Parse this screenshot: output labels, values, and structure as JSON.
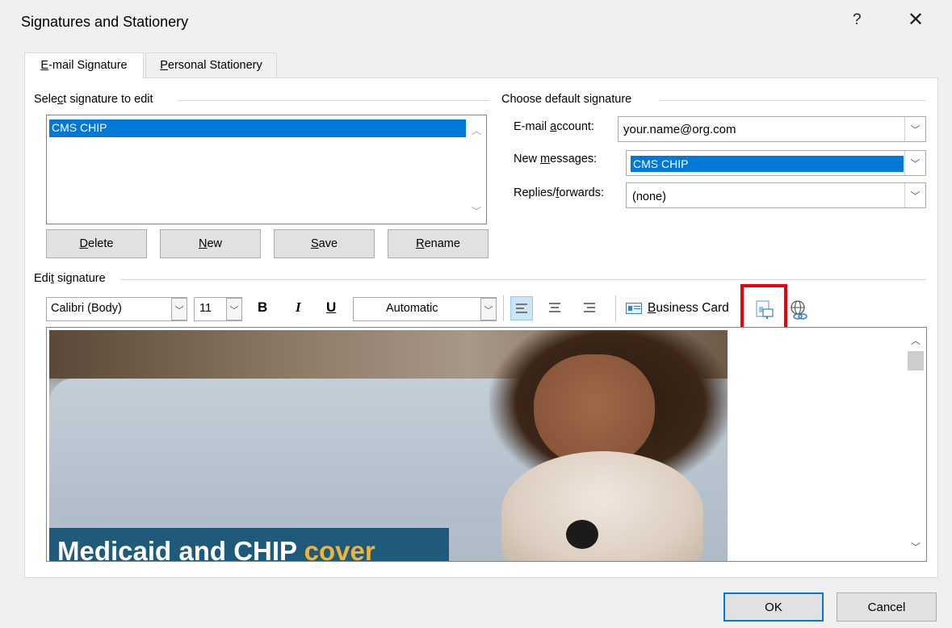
{
  "window": {
    "title": "Signatures and Stationery",
    "help_glyph": "?",
    "close_glyph": "✕"
  },
  "tabs": [
    {
      "accel": "E",
      "rest": "-mail Signature",
      "active": true
    },
    {
      "accel": "P",
      "rest": "ersonal Stationery",
      "active": false
    }
  ],
  "select_signature": {
    "label_pre": "Sele",
    "label_accel": "c",
    "label_post": "t signature to edit",
    "items": [
      "CMS CHIP"
    ],
    "selected": "CMS CHIP"
  },
  "buttons": {
    "delete": {
      "accel": "D",
      "rest": "elete"
    },
    "new": {
      "accel": "N",
      "rest": "ew"
    },
    "save": {
      "accel": "S",
      "rest": "ave"
    },
    "rename": {
      "accel": "R",
      "rest": "ename"
    }
  },
  "default_signature": {
    "group_label": "Choose default signature",
    "email_account_label_pre": "E-mail ",
    "email_account_label_accel": "a",
    "email_account_label_post": "ccount:",
    "email_account_value": "your.name@org.com",
    "new_messages_label_pre": "New ",
    "new_messages_label_accel": "m",
    "new_messages_label_post": "essages:",
    "new_messages_value": "CMS CHIP",
    "replies_label_pre": "Replies/",
    "replies_label_accel": "f",
    "replies_label_post": "orwards:",
    "replies_value": "(none)"
  },
  "edit_signature": {
    "label_pre": "Edi",
    "label_accel": "t",
    "label_post": " signature",
    "font": "Calibri (Body)",
    "size": "11",
    "bold": "B",
    "italic": "I",
    "underline": "U",
    "color": "Automatic",
    "business_card_accel": "B",
    "business_card_rest": "usiness Card",
    "banner_text": "Medicaid and CHIP",
    "banner_accent": "cover"
  },
  "footer": {
    "ok": "OK",
    "cancel": "Cancel"
  },
  "colors": {
    "selection": "#0078d7",
    "highlight_box": "#e8000b",
    "banner_bg": "#1f5a7a",
    "banner_accent": "#f0b23a"
  }
}
